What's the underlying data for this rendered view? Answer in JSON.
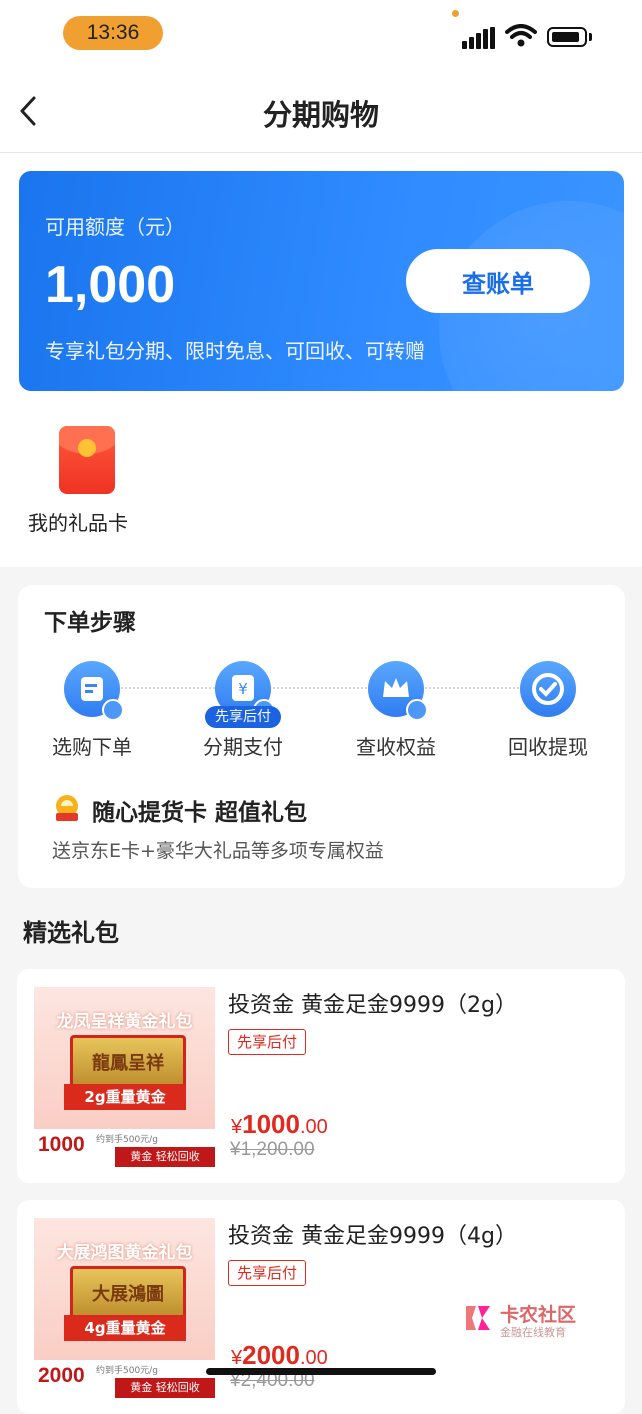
{
  "status": {
    "time": "13:36"
  },
  "nav": {
    "title": "分期购物"
  },
  "credit": {
    "label": "可用额度（元）",
    "amount": "1,000",
    "desc": "专享礼包分期、限时免息、可回收、可转赠",
    "button": "查账单"
  },
  "gift_card": {
    "label": "我的礼品卡"
  },
  "steps": {
    "title": "下单步骤",
    "items": [
      {
        "label": "选购下单"
      },
      {
        "label": "分期支付"
      },
      {
        "label": "查收权益"
      },
      {
        "label": "回收提现"
      }
    ],
    "badge": "先享后付",
    "promo_title": "随心提货卡 超值礼包",
    "promo_desc": "送京东E卡+豪华大礼品等多项专属权益"
  },
  "section_title": "精选礼包",
  "products": [
    {
      "img_title": "龙凤呈祥黄金礼包",
      "bar_text": "龍鳳呈祥",
      "weight": "2g重量黄金",
      "img_price": "1000",
      "img_note": "约到手500元/g",
      "img_tag": "黄金 轻松回收",
      "name": "投资金 黄金足金9999（2g）",
      "tag": "先享后付",
      "price_symbol": "¥",
      "price_int": "1000",
      "price_dec": ".00",
      "orig_price": "¥1,200.00"
    },
    {
      "img_title": "大展鸿图黄金礼包",
      "bar_text": "大展鴻圖",
      "weight": "4g重量黄金",
      "img_price": "2000",
      "img_note": "约到手500元/g",
      "img_tag": "黄金 轻松回收",
      "name": "投资金 黄金足金9999（4g）",
      "tag": "先享后付",
      "price_symbol": "¥",
      "price_int": "2000",
      "price_dec": ".00",
      "orig_price": "¥2,400.00"
    }
  ],
  "watermark": {
    "title": "卡农社区",
    "sub": "金融在线教育"
  }
}
